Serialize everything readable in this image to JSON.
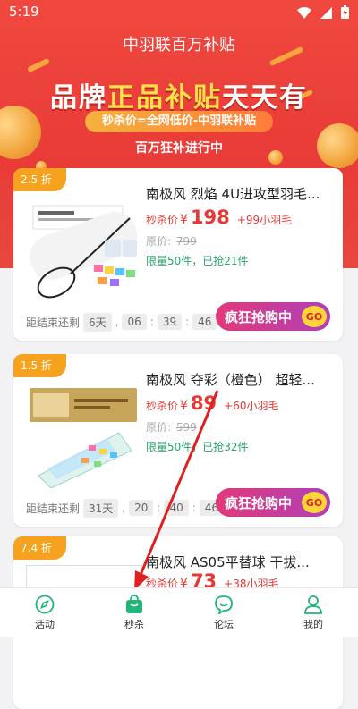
{
  "status_bar": {
    "time": "5:19"
  },
  "header": {
    "title": "中羽联百万补贴"
  },
  "banner": {
    "headline_part1": "品牌",
    "headline_highlight": "正品补贴",
    "headline_part2": "天天有",
    "tagline": "秒杀价=全网低价-中羽联补贴",
    "subtitle": "百万狂补进行中"
  },
  "products": [
    {
      "badge": "2.5 折",
      "name": "南极风 烈焰 4U进攻型羽毛...",
      "price_label": "秒杀价",
      "currency": "¥",
      "price": "198",
      "bonus": "+99小羽毛",
      "original_label": "原价:",
      "original_price": "799",
      "limit": "限量50件，已抢21件",
      "countdown_label": "距结束还剩",
      "countdown": [
        "6天",
        "06",
        "39",
        "46"
      ],
      "buy_label": "疯狂抢购中",
      "go_label": "GO"
    },
    {
      "badge": "1.5 折",
      "name": "南极风 夺彩（橙色） 超轻...",
      "price_label": "秒杀价",
      "currency": "¥",
      "price": "89",
      "bonus": "+60小羽毛",
      "original_label": "原价:",
      "original_price": "599",
      "limit": "限量50件，已抢32件",
      "countdown_label": "距结束还剩",
      "countdown": [
        "31天",
        "20",
        "40",
        "46"
      ],
      "buy_label": "疯狂抢购中",
      "go_label": "GO"
    },
    {
      "badge": "7.4 折",
      "name": "南极风 AS05平替球 干拔...",
      "price_label": "秒杀价",
      "currency": "¥",
      "price": "73",
      "bonus": "+38小羽毛"
    }
  ],
  "tabs": [
    {
      "label": "活动",
      "icon": "compass-icon"
    },
    {
      "label": "秒杀",
      "icon": "shopping-bag-icon",
      "active": true
    },
    {
      "label": "论坛",
      "icon": "chat-bubble-icon"
    },
    {
      "label": "我的",
      "icon": "person-icon"
    }
  ],
  "colors": {
    "hero_red": "#e93b37",
    "price_red": "#e53935",
    "badge_orange": "#f6a21e",
    "limit_green": "#29a36a",
    "active_tab_green": "#21b577"
  }
}
